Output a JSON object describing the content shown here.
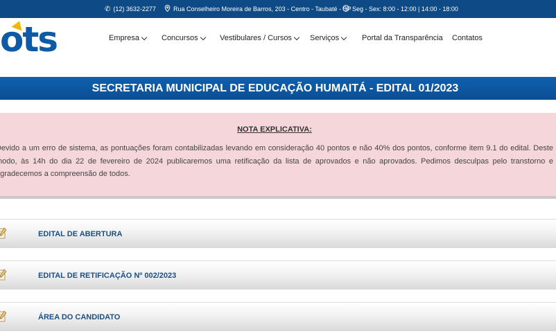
{
  "topbar": {
    "phone": "(12) 3632-2277",
    "address": "Rua Conselheiro Moreira de Barros, 203 - Centro - Taubaté - SP",
    "hours": "Seg - Sex: 8:00 - 12:00 | 14:00 - 18:00"
  },
  "logo": {
    "text": "ots"
  },
  "nav": {
    "items": [
      {
        "label": "Empresa"
      },
      {
        "label": "Concursos"
      },
      {
        "label": "Vestibulares / Cursos"
      },
      {
        "label": "Serviços"
      },
      {
        "label": "Portal da Transparência"
      },
      {
        "label": "Contatos"
      }
    ]
  },
  "page": {
    "title": "SECRETARIA MUNICIPAL DE EDUCAÇÃO HUMAITÁ - EDITAL 01/2023"
  },
  "note": {
    "title": "NOTA EXPLICATIVA:",
    "text": "Devido a um erro de sistema, as pontuações foram contabilizadas levando em consideração 40 pontos e não 40% dos pontos, conforme item 9.1 do edital. Deste modo, às 14h do dia 22 de fevereiro de 2024 publicaremos uma retificação da lista de aprovados e não aprovados. Pedimos desculpas pelo transtorno e agradecemos a compreensão de todos."
  },
  "accordion": [
    {
      "label": "EDITAL DE ABERTURA"
    },
    {
      "label": "EDITAL DE RETIFICAÇÃO Nº 002/2023"
    },
    {
      "label": "ÁREA DO CANDIDATO"
    }
  ],
  "colors": {
    "primary": "#0d4a86",
    "note_bg": "#f5d6db",
    "accent": "#f2b705"
  }
}
